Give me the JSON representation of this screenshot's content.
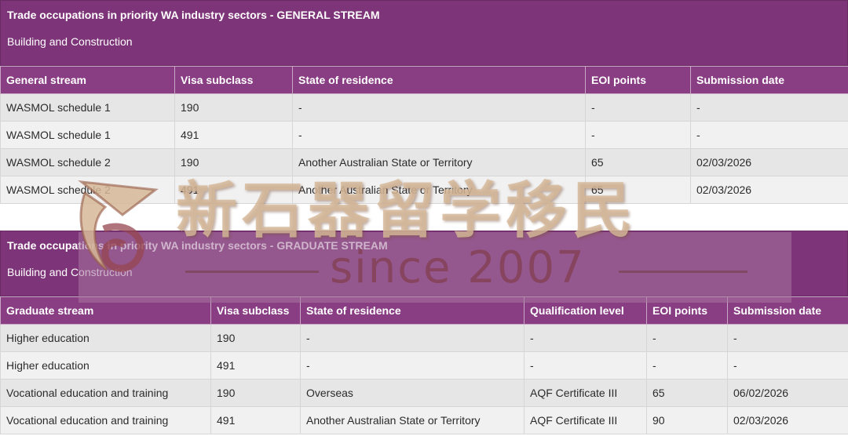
{
  "general": {
    "title": "Trade occupations in priority WA industry sectors - GENERAL STREAM",
    "subtitle": "Building and Construction",
    "headers": [
      "General stream",
      "Visa subclass",
      "State of residence",
      "EOI points",
      "Submission date"
    ],
    "rows": [
      [
        "WASMOL schedule 1",
        "190",
        "-",
        "-",
        "-"
      ],
      [
        "WASMOL schedule 1",
        "491",
        "-",
        "-",
        "-"
      ],
      [
        "WASMOL schedule 2",
        "190",
        "Another Australian State or Territory",
        "65",
        "02/03/2026"
      ],
      [
        "WASMOL schedule 2",
        "491",
        "Another Australian State or Territory",
        "65",
        "02/03/2026"
      ]
    ]
  },
  "graduate": {
    "title": "Trade occupations in priority WA industry sectors - GRADUATE STREAM",
    "subtitle": "Building and Construction",
    "headers": [
      "Graduate stream",
      "Visa subclass",
      "State of residence",
      "Qualification level",
      "EOI points",
      "Submission date"
    ],
    "rows": [
      [
        "Higher education",
        "190",
        "-",
        "-",
        "-",
        "-"
      ],
      [
        "Higher education",
        "491",
        "-",
        "-",
        "-",
        "-"
      ],
      [
        "Vocational education and training",
        "190",
        "Overseas",
        "AQF Certificate III",
        "65",
        "06/02/2026"
      ],
      [
        "Vocational education and training",
        "491",
        "Another Australian State or Territory",
        "AQF Certificate III",
        "90",
        "02/03/2026"
      ]
    ]
  },
  "watermark": {
    "chinese_text": "新石器留学移民",
    "since_text": "since 2007",
    "logo_icon": "stylized-letter-logo-icon",
    "band_color": "#a876a0",
    "text_color": "#d6b898"
  },
  "colors": {
    "banner": "#7e3478",
    "header": "#893d83",
    "row_odd": "#e6e6e6",
    "row_even": "#f1f1f1"
  }
}
